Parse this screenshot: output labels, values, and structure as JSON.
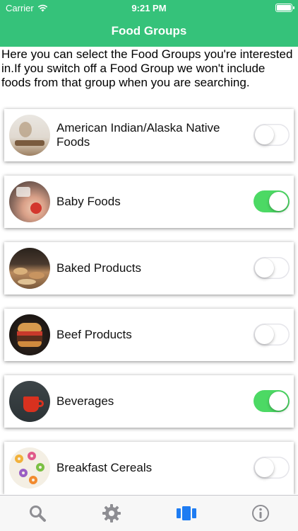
{
  "status": {
    "carrier": "Carrier",
    "time": "9:21 PM"
  },
  "header": {
    "title": "Food Groups"
  },
  "intro": "Here you can select the Food Groups you're interested in.If you switch off a Food Group we won't include foods from that group when you are searching.",
  "groups": [
    {
      "label": "American Indian/Alaska Native Foods",
      "enabled": false
    },
    {
      "label": "Baby Foods",
      "enabled": true
    },
    {
      "label": "Baked Products",
      "enabled": false
    },
    {
      "label": "Beef Products",
      "enabled": false
    },
    {
      "label": "Beverages",
      "enabled": true
    },
    {
      "label": "Breakfast Cereals",
      "enabled": false
    }
  ],
  "tabs": [
    {
      "icon": "search-icon",
      "selected": false
    },
    {
      "icon": "gear-icon",
      "selected": false
    },
    {
      "icon": "food-groups-icon",
      "selected": true
    },
    {
      "icon": "info-icon",
      "selected": false
    }
  ],
  "colors": {
    "accent": "#35c27a",
    "switch_on": "#4cd964",
    "tab_selected": "#1e7cf2",
    "tab_unselected": "#8e8e93"
  }
}
